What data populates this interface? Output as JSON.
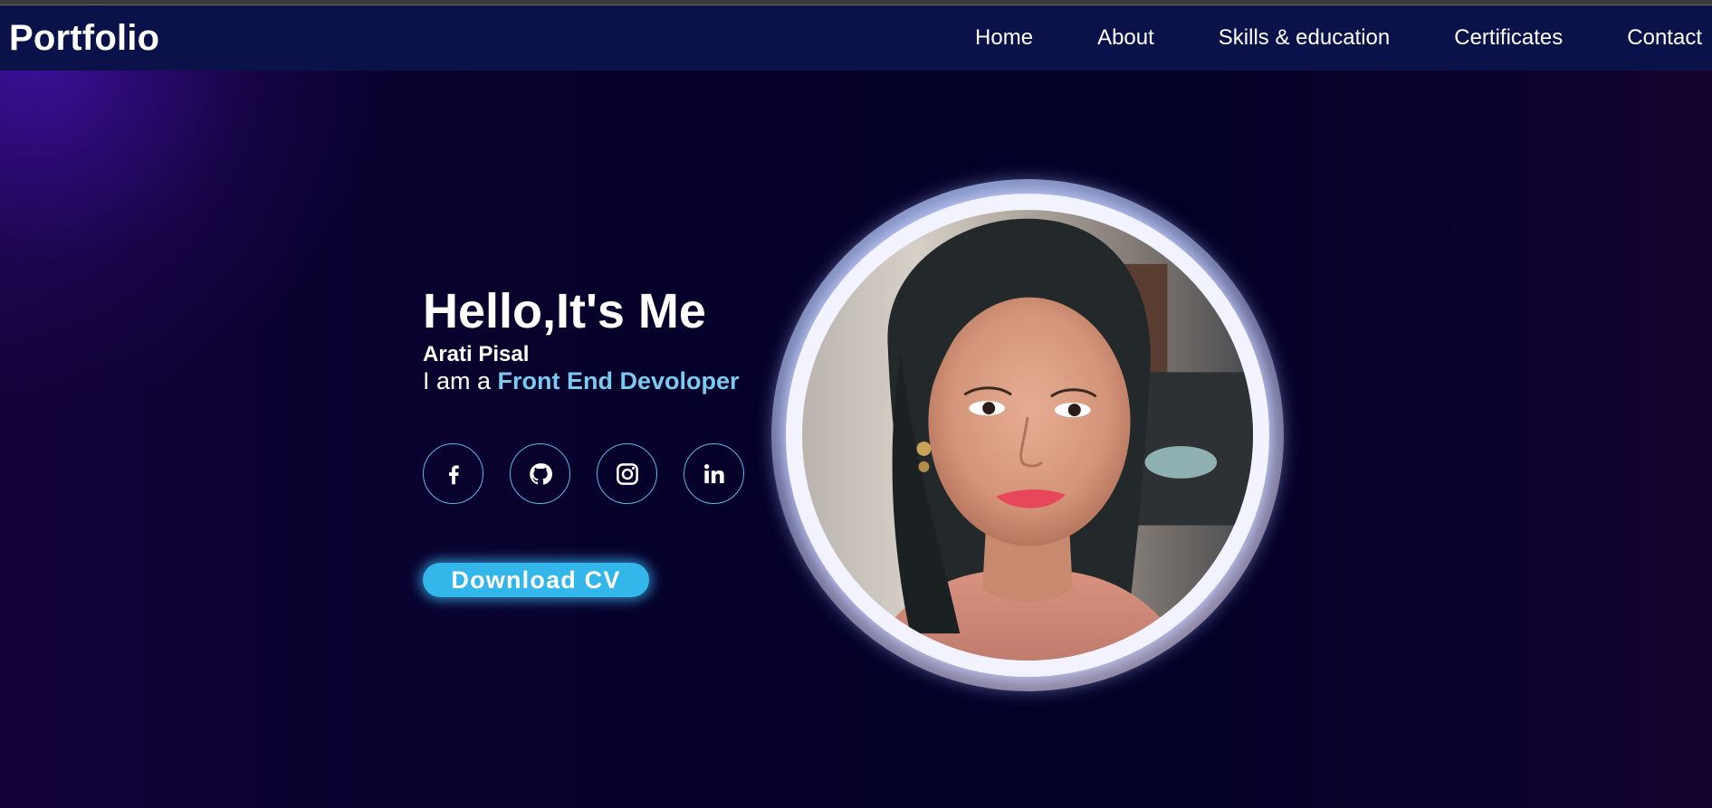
{
  "brand": {
    "logo": "Portfolio"
  },
  "nav": {
    "items": [
      {
        "label": "Home"
      },
      {
        "label": "About"
      },
      {
        "label": "Skills & education"
      },
      {
        "label": "Certificates"
      },
      {
        "label": "Contact"
      }
    ]
  },
  "hero": {
    "greeting": "Hello,It's Me",
    "name": "Arati Pisal",
    "role_prefix": "I am a",
    "role_highlight": "Front End Devoloper",
    "cv_button": "Download CV"
  },
  "socials": [
    {
      "icon": "facebook-icon"
    },
    {
      "icon": "github-icon"
    },
    {
      "icon": "instagram-icon"
    },
    {
      "icon": "linkedin-icon"
    }
  ],
  "colors": {
    "accent": "#7ccbee",
    "button": "#33b6ea",
    "navbar": "#0b1149",
    "background": "#05012a"
  }
}
